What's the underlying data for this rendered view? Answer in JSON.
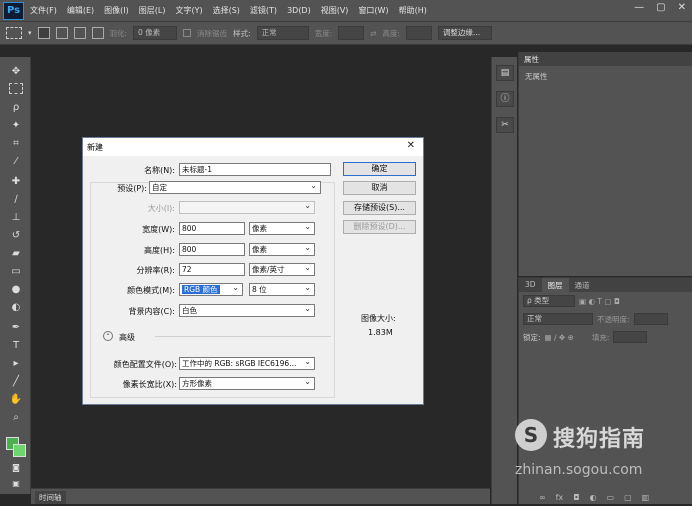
{
  "app": {
    "logo": "Ps",
    "win_controls": [
      "—",
      "▢",
      "✕"
    ]
  },
  "menu": [
    "文件(F)",
    "编辑(E)",
    "图像(I)",
    "图层(L)",
    "文字(Y)",
    "选择(S)",
    "滤镜(T)",
    "3D(D)",
    "视图(V)",
    "窗口(W)",
    "帮助(H)"
  ],
  "options": {
    "feather_label": "羽化:",
    "feather_value": "0 像素",
    "antialias": "消除锯齿",
    "style_label": "样式:",
    "style_value": "正常",
    "width_label": "宽度:",
    "height_label": "高度:",
    "refine_edge": "调整边缘..."
  },
  "panels": {
    "props_tab": "属性",
    "props_empty": "无属性",
    "layers_tabs": [
      "3D",
      "图层",
      "通道"
    ],
    "kind_label": "ρ 类型",
    "blend_mode": "正常",
    "opacity_label": "不透明度:",
    "lock_label": "锁定:",
    "fill_label": "填充:",
    "timeline_tab": "时间轴"
  },
  "dialog": {
    "title": "新建",
    "name_label": "名称(N):",
    "name_value": "未标题-1",
    "preset_label": "预设(P):",
    "preset_value": "自定",
    "size_label": "大小(I):",
    "width_label": "宽度(W):",
    "width_value": "800",
    "width_unit": "像素",
    "height_label": "高度(H):",
    "height_value": "800",
    "height_unit": "像素",
    "resolution_label": "分辨率(R):",
    "resolution_value": "72",
    "resolution_unit": "像素/英寸",
    "color_mode_label": "颜色模式(M):",
    "color_mode_value": "RGB 颜色",
    "bit_depth": "8 位",
    "background_label": "背景内容(C):",
    "background_value": "白色",
    "advanced_label": "高级",
    "color_profile_label": "颜色配置文件(O):",
    "color_profile_value": "工作中的 RGB: sRGB IEC6196...",
    "pixel_aspect_label": "像素长宽比(X):",
    "pixel_aspect_value": "方形像素",
    "ok": "确定",
    "cancel": "取消",
    "save_preset": "存储预设(S)...",
    "delete_preset": "删除预设(D)...",
    "image_size_label": "图像大小:",
    "image_size_value": "1.83M"
  },
  "watermark": {
    "logo": "S",
    "text": "搜狗指南",
    "url": "zhinan.sogou.com"
  },
  "colors": {
    "fg_swatch": "#4caf50",
    "bg_swatch": "#6fd36f",
    "accent": "#2b6fd6"
  }
}
